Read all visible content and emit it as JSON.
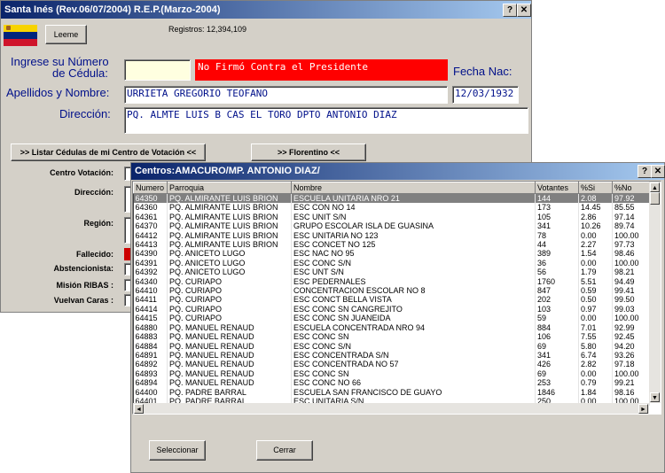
{
  "main_window": {
    "title": "Santa Inés (Rev.06/07/2004) R.E.P.(Marzo-2004)",
    "help_btn": "?",
    "close_btn": "✕",
    "leeme": "Leeme",
    "registros": "Registros: 12,394,109",
    "cedula_label_1": "Ingrese su Número",
    "cedula_label_2": "de Cédula:",
    "cedula_value": "",
    "status_banner": "No Firmó Contra el Presidente",
    "fecha_label": "Fecha Nac:",
    "fecha_value": "12/03/1932",
    "nombre_label": "Apellidos y Nombre:",
    "nombre_value": "URRIETA  GREGORIO TEOFANO",
    "direccion_label": "Dirección:",
    "direccion_value": "PQ. ALMTE LUIS B CAS EL TORO DPTO ANTONIO DIAZ",
    "listar_btn": ">> Listar Cédulas de mi Centro de Votación <<",
    "florentino_btn": ">> Florentino <<",
    "centro_label": "Centro Votación:",
    "direccion2_label": "Dirección:",
    "region_label": "Región:",
    "fallecido_label": "Fallecido:",
    "abstencionista_label": "Abstencionista:",
    "mision_label": "Misión RIBAS :",
    "vuelvan_label": "Vuelvan Caras :",
    "flag_colors": [
      "#f7d300",
      "#00247d",
      "#cf142b"
    ]
  },
  "popup": {
    "title": "Centros:AMACURO/MP. ANTONIO DIAZ/",
    "help_btn": "?",
    "close_btn": "✕",
    "columns": [
      "Numero",
      "Parroquia",
      "Nombre",
      "Votantes",
      "%Si",
      "%No"
    ],
    "rows": [
      [
        "64350",
        "PQ. ALMIRANTE LUIS BRION",
        "ESCUELA UNITARIA NRO 21",
        "144",
        "2.08",
        "97.92"
      ],
      [
        "64360",
        "PQ. ALMIRANTE LUIS BRION",
        "ESC CON NO 14",
        "173",
        "14.45",
        "85.55"
      ],
      [
        "64361",
        "PQ. ALMIRANTE LUIS BRION",
        "ESC UNIT S/N",
        "105",
        "2.86",
        "97.14"
      ],
      [
        "64370",
        "PQ. ALMIRANTE LUIS BRION",
        "GRUPO ESCOLAR ISLA DE GUASINA",
        "341",
        "10.26",
        "89.74"
      ],
      [
        "64412",
        "PQ. ALMIRANTE LUIS BRION",
        "ESC UNITARIA NO 123",
        "78",
        "0.00",
        "100.00"
      ],
      [
        "64413",
        "PQ. ALMIRANTE LUIS BRION",
        "ESC CONCET NO 125",
        "44",
        "2.27",
        "97.73"
      ],
      [
        "64390",
        "PQ. ANICETO LUGO",
        "ESC NAC NO 95",
        "389",
        "1.54",
        "98.46"
      ],
      [
        "64391",
        "PQ. ANICETO LUGO",
        "ESC CONC S/N",
        "36",
        "0.00",
        "100.00"
      ],
      [
        "64392",
        "PQ. ANICETO LUGO",
        "ESC UNT S/N",
        "56",
        "1.79",
        "98.21"
      ],
      [
        "64340",
        "PQ. CURIAPO",
        "ESC PEDERNALES",
        "1760",
        "5.51",
        "94.49"
      ],
      [
        "64410",
        "PQ. CURIAPO",
        "CONCENTRACION ESCOLAR NO 8",
        "847",
        "0.59",
        "99.41"
      ],
      [
        "64411",
        "PQ. CURIAPO",
        "ESC CONCT BELLA VISTA",
        "202",
        "0.50",
        "99.50"
      ],
      [
        "64414",
        "PQ. CURIAPO",
        "ESC CONC SN CANGREJITO",
        "103",
        "0.97",
        "99.03"
      ],
      [
        "64415",
        "PQ. CURIAPO",
        "ESC CONC SN JUANEIDA",
        "59",
        "0.00",
        "100.00"
      ],
      [
        "64880",
        "PQ. MANUEL RENAUD",
        "ESCUELA CONCENTRADA NRO 94",
        "884",
        "7.01",
        "92.99"
      ],
      [
        "64883",
        "PQ. MANUEL RENAUD",
        "ESC CONC SN",
        "106",
        "7.55",
        "92.45"
      ],
      [
        "64884",
        "PQ. MANUEL RENAUD",
        "ESC CONC S/N",
        "69",
        "5.80",
        "94.20"
      ],
      [
        "64891",
        "PQ. MANUEL RENAUD",
        "ESC CONCENTRADA S/N",
        "341",
        "6.74",
        "93.26"
      ],
      [
        "64892",
        "PQ. MANUEL RENAUD",
        "ESC CONCENTRADA NO 57",
        "426",
        "2.82",
        "97.18"
      ],
      [
        "64893",
        "PQ. MANUEL RENAUD",
        "ESC CONC SN",
        "69",
        "0.00",
        "100.00"
      ],
      [
        "64894",
        "PQ. MANUEL RENAUD",
        "ESC CONC NO 66",
        "253",
        "0.79",
        "99.21"
      ],
      [
        "64400",
        "PQ. PADRE BARRAL",
        "ESCUELA SAN FRANCISCO DE GUAYO",
        "1846",
        "1.84",
        "98.16"
      ],
      [
        "64401",
        "PQ. PADRE BARRAL",
        "ESC UNITARIA S/N",
        "250",
        "0.00",
        "100.00"
      ]
    ],
    "selected_row": 0,
    "seleccionar": "Seleccionar",
    "cerrar": "Cerrar",
    "scroll_up": "▲",
    "scroll_down": "▼",
    "scroll_left": "◄",
    "scroll_right": "►"
  }
}
